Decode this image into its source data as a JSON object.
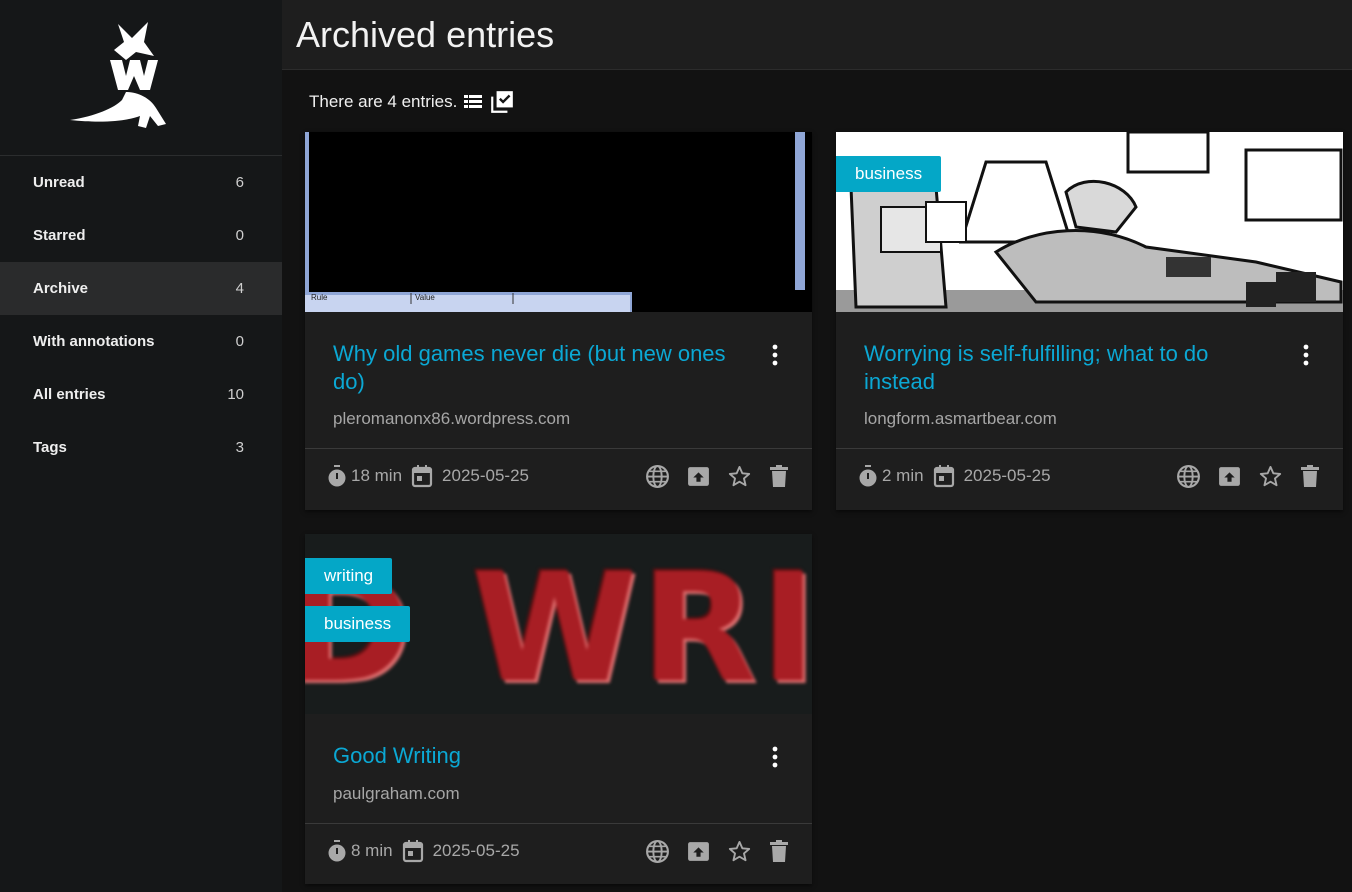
{
  "header": {
    "title": "Archived entries"
  },
  "summary": {
    "text": "There are 4 entries."
  },
  "sidebar": {
    "items": [
      {
        "label": "Unread",
        "count": "6"
      },
      {
        "label": "Starred",
        "count": "0"
      },
      {
        "label": "Archive",
        "count": "4"
      },
      {
        "label": "With annotations",
        "count": "0"
      },
      {
        "label": "All entries",
        "count": "10"
      },
      {
        "label": "Tags",
        "count": "3"
      }
    ]
  },
  "entries": [
    {
      "title": "Why old games never die (but new ones do)",
      "domain": "pleromanonx86.wordpress.com",
      "reading_time": "18 min",
      "date": "2025-05-25",
      "tags": [],
      "thumb_labels": [
        "Rule",
        "Value"
      ]
    },
    {
      "title": "Worrying is self-fulfilling; what to do instead",
      "domain": "longform.asmartbear.com",
      "reading_time": "2 min",
      "date": "2025-05-25",
      "tags": [
        "business"
      ]
    },
    {
      "title": "Good Writing",
      "domain": "paulgraham.com",
      "reading_time": "8 min",
      "date": "2025-05-25",
      "tags": [
        "writing",
        "business"
      ],
      "thumb_text": "D WRIT"
    }
  ],
  "icons": {
    "list_view": "list-view-icon",
    "select_mode": "check-square-icon",
    "timer": "timer-icon",
    "calendar": "calendar-icon",
    "globe": "globe-icon",
    "unarchive": "unarchive-icon",
    "star": "star-outline-icon",
    "delete": "trash-icon",
    "menu": "more-vert-icon"
  },
  "colors": {
    "accent": "#04a7c7",
    "link": "#0ba8d4"
  }
}
